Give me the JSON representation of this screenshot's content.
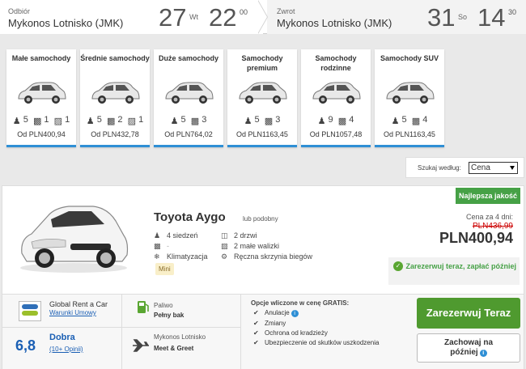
{
  "search": {
    "pickup": {
      "label": "Odbiór",
      "location": "Mykonos Lotnisko (JMK)",
      "day": "27",
      "weekday": "Wt",
      "hour": "22",
      "minute": "00"
    },
    "return": {
      "label": "Zwrot",
      "location": "Mykonos Lotnisko (JMK)",
      "day": "31",
      "weekday": "So",
      "hour": "14",
      "minute": "30"
    }
  },
  "categories": [
    {
      "name": "Małe samochody",
      "seats": "5",
      "bags_big": "1",
      "bags_small": "1",
      "price": "Od PLN400,94"
    },
    {
      "name": "Średnie samochody",
      "seats": "5",
      "bags_big": "2",
      "bags_small": "1",
      "price": "Od PLN432,78"
    },
    {
      "name": "Duże samochody",
      "seats": "5",
      "bags_big": "3",
      "bags_small": "",
      "price": "Od PLN764,02"
    },
    {
      "name": "Samochody premium",
      "seats": "5",
      "bags_big": "3",
      "bags_small": "",
      "price": "Od PLN1163,45"
    },
    {
      "name": "Samochody rodzinne",
      "seats": "9",
      "bags_big": "4",
      "bags_small": "",
      "price": "Od PLN1057,48"
    },
    {
      "name": "Samochody SUV",
      "seats": "5",
      "bags_big": "4",
      "bags_small": "",
      "price": "Od PLN1163,45"
    }
  ],
  "sort": {
    "label": "Szukaj według:",
    "selected": "Cena"
  },
  "offer": {
    "badge": "Najlepsza jakość",
    "title": "Toyota Aygo",
    "similar": "lub podobny",
    "features": {
      "seats": "4 siedzeń",
      "doors": "2 drzwi",
      "bags_big": "-",
      "bags_small": "2 małe walizki",
      "ac": "Klimatyzacja",
      "transmission": "Ręczna skrzynia biegów"
    },
    "class_tag": "Mini",
    "price_label": "Cena za 4 dni:",
    "old_price": "PLN436,99",
    "price": "PLN400,94",
    "free_cancel": "Zarezerwuj teraz, zapłać później",
    "supplier": {
      "name": "Global Rent a Car",
      "terms": "Warunki Umowy",
      "logo_text": "GLOBAL"
    },
    "rating": {
      "score": "6,8",
      "word": "Dobra",
      "count": "(10+ Opinii)"
    },
    "fuel": {
      "label": "Paliwo",
      "value": "Pełny bak"
    },
    "pickup": {
      "label": "Mykonos Lotnisko",
      "value": "Meet & Greet"
    },
    "included": {
      "title": "Opcje wliczone w cenę GRATIS:",
      "items": [
        "Anulacje",
        "Zmiany",
        "Ochrona od kradzieży",
        "Ubezpieczenie od skutków uszkodzenia"
      ]
    },
    "book_label": "Zarezerwuj Teraz",
    "save_label_1": "Zachowaj na",
    "save_label_2": "później"
  }
}
